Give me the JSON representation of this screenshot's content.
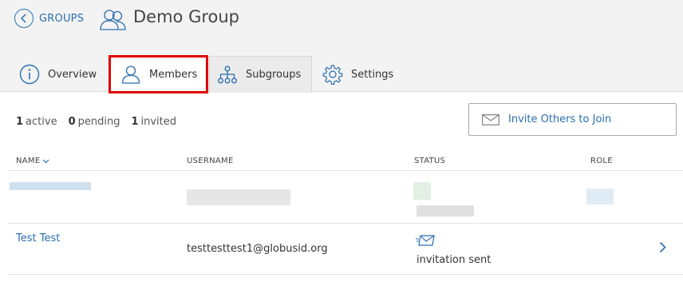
{
  "nav": {
    "back_label": "GROUPS"
  },
  "group": {
    "title": "Demo Group"
  },
  "tabs": [
    {
      "label": "Overview"
    },
    {
      "label": "Members"
    },
    {
      "label": "Subgroups"
    },
    {
      "label": "Settings"
    }
  ],
  "counts": {
    "active_n": "1",
    "active_label": "active",
    "pending_n": "0",
    "pending_label": "pending",
    "invited_n": "1",
    "invited_label": "invited"
  },
  "invite": {
    "label": "Invite Others to Join"
  },
  "table": {
    "headers": {
      "name": "NAME",
      "username": "USERNAME",
      "status": "STATUS",
      "role": "ROLE"
    },
    "rows": [
      {
        "name": "Test Test",
        "username": "testtesttest1@globusid.org",
        "status": "invitation sent"
      }
    ]
  },
  "colors": {
    "accent": "#2a6fb0",
    "highlight": "#e00000"
  }
}
